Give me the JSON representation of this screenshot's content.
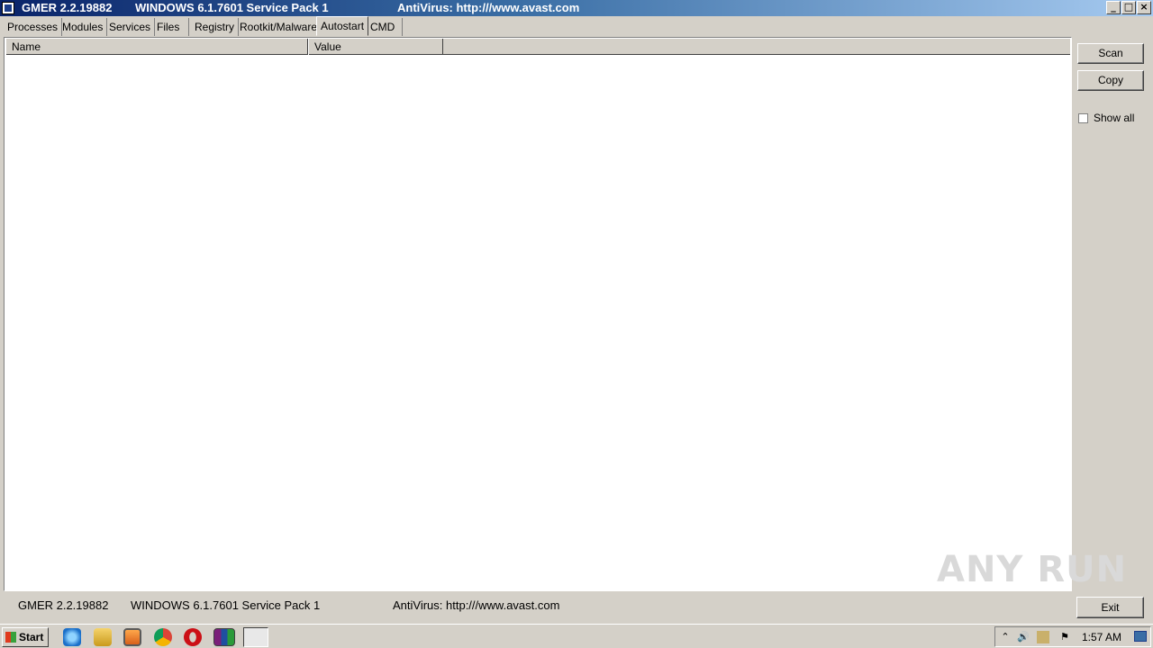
{
  "window": {
    "title_app": "GMER 2.2.19882",
    "title_os": "WINDOWS 6.1.7601 Service Pack 1",
    "title_av": "AntiVirus: http:///www.avast.com",
    "controls": [
      "_",
      "□",
      "×"
    ]
  },
  "tabs": [
    "Processes",
    "Modules",
    "Services",
    "Files",
    "Registry",
    "Rootkit/Malware",
    "Autostart",
    "CMD"
  ],
  "active_tab": "Autostart",
  "list": {
    "columns": [
      "Name",
      "Value"
    ],
    "rows": []
  },
  "side": {
    "scan_label": "Scan",
    "copy_label": "Copy",
    "show_all_label": "Show all",
    "show_all_checked": false,
    "exit_label": "Exit"
  },
  "status": {
    "app": "GMER 2.2.19882",
    "os": "WINDOWS 6.1.7601 Service Pack 1",
    "av": "AntiVirus: http:///www.avast.com"
  },
  "watermark": "ANY RUN",
  "taskbar": {
    "start_label": "Start",
    "apps": [
      "ie-icon",
      "explorer-icon",
      "media-player-icon",
      "chrome-icon",
      "opera-icon",
      "winrar-icon",
      "gmer-icon"
    ],
    "clock": "1:57 AM"
  }
}
